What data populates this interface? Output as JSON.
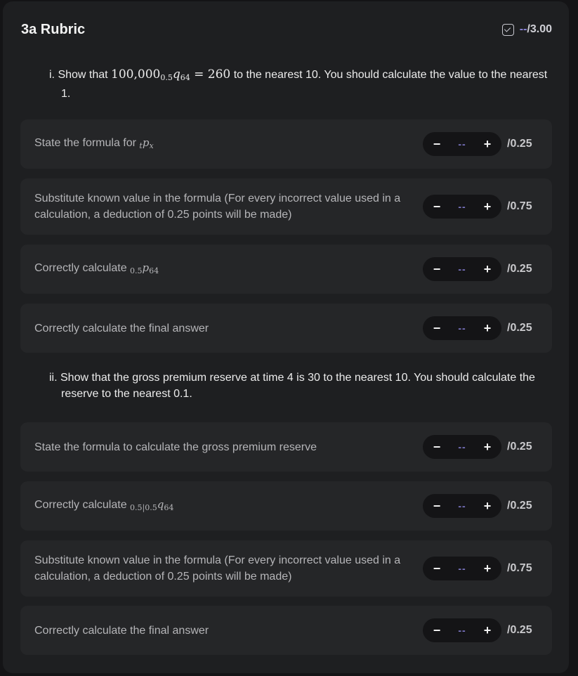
{
  "header": {
    "title": "3a Rubric",
    "score_dashes": "--",
    "score_total": "/3.00"
  },
  "sections": [
    {
      "prefix": "i. Show that ",
      "math": "100,000",
      "math_sub": "0.5",
      "math_q": "q",
      "math_sub2": "64",
      "math_eq": " = 260",
      "suffix": " to the nearest 10. You should calculate the value to the nearest 1.",
      "criteria": [
        {
          "text": "State the formula for ",
          "math_pre": "t",
          "math_main": "p",
          "math_sub": "x",
          "value": "--",
          "max": "/0.25"
        },
        {
          "text": "Substitute known value in the formula (For every incorrect value used in a calculation, a deduction of 0.25 points will be made)",
          "value": "--",
          "max": "/0.75"
        },
        {
          "text": "Correctly calculate ",
          "math_pre": "0.5",
          "math_main": "p",
          "math_sub": "64",
          "value": "--",
          "max": "/0.25"
        },
        {
          "text": "Correctly calculate the final answer",
          "value": "--",
          "max": "/0.25"
        }
      ]
    },
    {
      "text": "ii. Show that the gross premium reserve at time 4 is 30 to the nearest 10. You should calculate the reserve to the nearest 0.1.",
      "criteria": [
        {
          "text": "State the formula to calculate the gross premium reserve",
          "value": "--",
          "max": "/0.25"
        },
        {
          "text": "Correctly calculate ",
          "math_pre": "0.5|0.5",
          "math_main": "q",
          "math_sub": "64",
          "value": "--",
          "max": "/0.25"
        },
        {
          "text": "Substitute known value in the formula (For every incorrect value used in a calculation, a deduction of 0.25 points will be made)",
          "value": "--",
          "max": "/0.75"
        },
        {
          "text": "Correctly calculate the final answer",
          "value": "--",
          "max": "/0.25"
        }
      ]
    }
  ],
  "controls": {
    "minus": "−",
    "plus": "+"
  }
}
